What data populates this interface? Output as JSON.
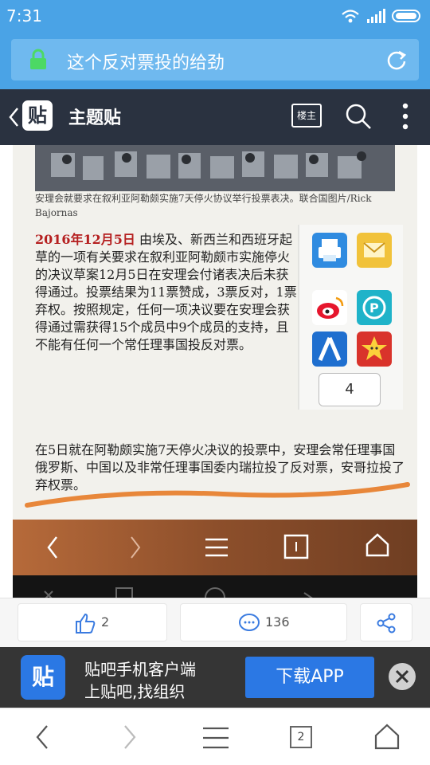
{
  "status_bar": {
    "time": "7:31"
  },
  "browser": {
    "page_title": "这个反对票投的给劲"
  },
  "navbar": {
    "logo": "贴",
    "title": "主题贴",
    "op_badge": "楼主"
  },
  "post_image": {
    "caption": "安理会就要求在叙利亚阿勒颇实施7天停火协议举行投票表决。联合国图片/Rick Bajornas",
    "date": "2016年12月5日",
    "body": "由埃及、新西兰和西班牙起草的一项有关要求在叙利亚阿勒颇市实施停火的决议草案12月5日在安理会付诸表决后未获得通过。投票结果为11票赞成，3票反对，1票弃权。按照规定，任何一项决议要在安理会获得通过需获得15个成员中9个成员的支持，且不能有任何一个常任理事国投反对票。",
    "share_count": "4",
    "paragraph2": "在5日就在阿勒颇实施7天停火决议的投票中，安理会常任理事国俄罗斯、中国以及非常任理事国委内瑞拉投了反对票，安哥拉投了弃权票。",
    "icons": [
      "printer-icon",
      "mail-icon",
      "weibo-icon",
      "pinterest-icon",
      "renren-icon",
      "star-icon"
    ]
  },
  "actions": {
    "likes": "2",
    "comments": "136"
  },
  "banner": {
    "logo": "贴",
    "line1": "贴吧手机客户端",
    "line2": "上贴吧,找组织",
    "download": "下载APP"
  },
  "bottom_nav": {
    "tabs": "2"
  },
  "colors": {
    "accent": "#4aa3e6",
    "brand_blue": "#2b78e4",
    "navbar": "#2a3240",
    "underline": "#e8873a"
  }
}
